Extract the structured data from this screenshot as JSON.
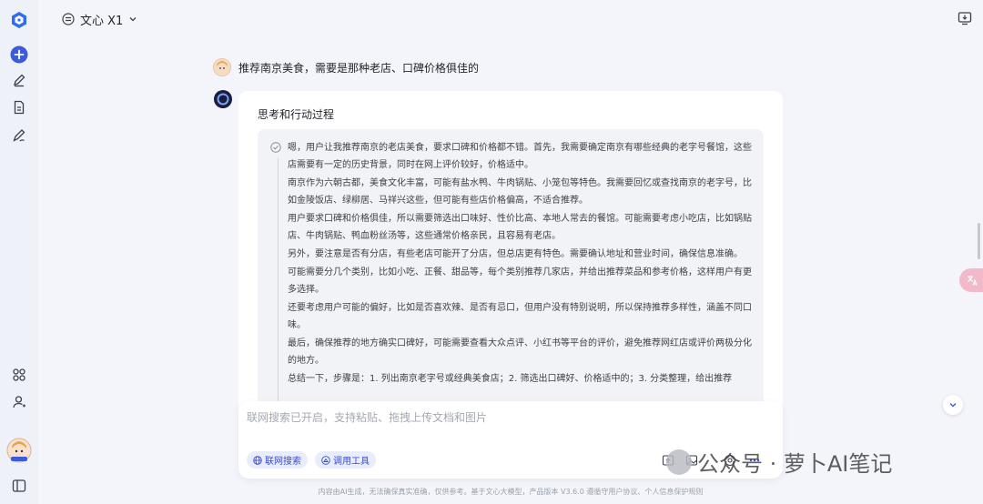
{
  "header": {
    "model_name": "文心 X1"
  },
  "conversation": {
    "user_message": "推荐南京美食，需要是那种老店、口碑价格俱佳的",
    "section_title": "思考和行动过程",
    "thinking": [
      "嗯，用户让我推荐南京的老店美食，要求口碑和价格都不错。首先，我需要确定南京有哪些经典的老字号餐馆，这些店需要有一定的历史背景，同时在网上评价较好，价格适中。",
      "南京作为六朝古都，美食文化丰富，可能有盐水鸭、牛肉锅贴、小笼包等特色。我需要回忆或查找南京的老字号，比如金陵饭店、绿柳居、马祥兴这些，但可能有些店价格偏高，不适合推荐。",
      "用户要求口碑和价格俱佳，所以需要筛选出口味好、性价比高、本地人常去的餐馆。可能需要考虑小吃店，比如锅贴店、牛肉锅贴、鸭血粉丝汤等，这些通常价格亲民，且容易有老店。",
      "另外，要注意是否有分店，有些老店可能开了分店，但总店更有特色。需要确认地址和营业时间，确保信息准确。",
      "可能需要分几个类别，比如小吃、正餐、甜品等，每个类别推荐几家店，并给出推荐菜品和参考价格，这样用户有更多选择。",
      "还要考虑用户可能的偏好，比如是否喜欢辣、是否有忌口，但用户没有特别说明，所以保持推荐多样性，涵盖不同口味。",
      "最后，确保推荐的地方确实口碑好，可能需要查看大众点评、小红书等平台的评价，避免推荐网红店或评价两极分化的地方。",
      "总结一下，步骤是：1. 列出南京老字号或经典美食店；2. 筛选出口碑好、价格适中的；3. 分类整理，给出推荐"
    ]
  },
  "input": {
    "placeholder": "联网搜索已开启，支持粘贴、拖拽上传文档和图片",
    "chip_web_search": "联网搜索",
    "chip_tools": "调用工具"
  },
  "footer": {
    "disclaimer": "内容由AI生成，无法确保真实准确，仅供参考。基于文心大模型，产品版本 V3.6.0 遵循守用户协议、个人信息保护规则"
  },
  "watermark": {
    "text": "公众号 · 萝卜AI笔记"
  },
  "colors": {
    "accent": "#3b5bdb",
    "sidebar_bg": "#eef1f7",
    "page_bg": "#f3f5fa"
  }
}
